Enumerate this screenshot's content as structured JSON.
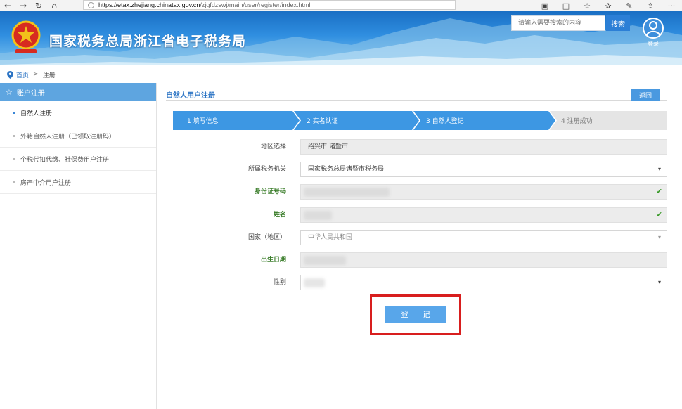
{
  "browser": {
    "back": "←",
    "forward": "→",
    "refresh": "↻",
    "home": "⌂",
    "url_info": "i",
    "url_host": "https://etax.zhejiang.chinatax.gov.cn",
    "url_path": "/zjgfdzswj/main/user/register/index.html",
    "tools": [
      "▣",
      "□",
      "☆",
      "✰",
      "✎",
      "⇪",
      "···"
    ]
  },
  "header": {
    "site_title": "国家税务总局浙江省电子税务局",
    "search_placeholder": "请输入需要搜索的内容",
    "search_button": "搜索",
    "login_label": "登录"
  },
  "breadcrumb": {
    "home": "首页",
    "arrow": ">",
    "current": "注册"
  },
  "sidebar": {
    "heading": "账户注册",
    "heading_icon": "☆",
    "items": [
      {
        "label": "自然人注册"
      },
      {
        "label": "外籍自然人注册（已领取注册码）"
      },
      {
        "label": "个税代扣代缴、社保费用户注册"
      },
      {
        "label": "房产中介用户注册"
      }
    ]
  },
  "main": {
    "title": "自然人用户注册",
    "back_button": "返回",
    "steps": [
      {
        "label": "1  填写信息",
        "state": "done"
      },
      {
        "label": "2  实名认证",
        "state": "done"
      },
      {
        "label": "3  自然人登记",
        "state": "current"
      },
      {
        "label": "4  注册成功",
        "state": "pending"
      }
    ],
    "form": {
      "region_label": "地区选择",
      "region_value": "绍兴市 诸暨市",
      "tax_office_label": "所属税务机关",
      "tax_office_value": "国家税务总局诸暨市税务局",
      "id_label": "身份证号码",
      "name_label": "姓名",
      "country_label": "国家（地区）",
      "country_value": "中华人民共和国",
      "birth_label": "出生日期",
      "gender_label": "性别",
      "caret": "▾",
      "check": "✔"
    },
    "submit_button": "登 记"
  },
  "colors": {
    "accent": "#2a73c4",
    "step_active": "#3d97e3",
    "step_pending": "#e5e5e5",
    "highlight": "#d81e1e"
  }
}
